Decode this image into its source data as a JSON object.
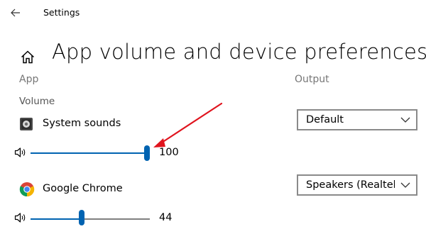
{
  "window": {
    "title": "Settings"
  },
  "page": {
    "title": "App volume and device preferences"
  },
  "columns": {
    "app_header": "App",
    "output_header": "Output"
  },
  "volume_label": "Volume",
  "apps": [
    {
      "name": "System sounds",
      "icon": "system-sounds-icon",
      "volume": 100,
      "volume_text": "100",
      "output": "Default"
    },
    {
      "name": "Google Chrome",
      "icon": "chrome-icon",
      "volume": 44,
      "volume_text": "44",
      "output": "Speakers (Realtek(R"
    }
  ],
  "colors": {
    "accent": "#0063b1",
    "annotation_arrow": "#e0141e"
  }
}
